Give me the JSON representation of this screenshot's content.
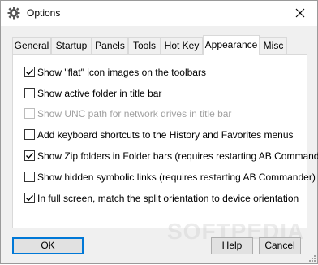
{
  "window": {
    "title": "Options",
    "icon": "gear-icon"
  },
  "tabs": [
    {
      "label": "General",
      "active": false
    },
    {
      "label": "Startup",
      "active": false
    },
    {
      "label": "Panels",
      "active": false
    },
    {
      "label": "Tools",
      "active": false
    },
    {
      "label": "Hot Key",
      "active": false
    },
    {
      "label": "Appearance",
      "active": true
    },
    {
      "label": "Misc",
      "active": false
    }
  ],
  "options": [
    {
      "label": "Show \"flat\" icon images on the toolbars",
      "checked": true,
      "enabled": true
    },
    {
      "label": "Show active folder in title bar",
      "checked": false,
      "enabled": true
    },
    {
      "label": "Show UNC path for network drives in title bar",
      "checked": false,
      "enabled": false
    },
    {
      "label": "Add keyboard shortcuts to the History and Favorites menus",
      "checked": false,
      "enabled": true
    },
    {
      "label": "Show Zip folders in Folder bars (requires restarting AB Commander)",
      "checked": true,
      "enabled": true
    },
    {
      "label": "Show hidden symbolic links (requires restarting AB Commander)",
      "checked": false,
      "enabled": true
    },
    {
      "label": "In full screen, match the split orientation to device orientation",
      "checked": true,
      "enabled": true
    }
  ],
  "buttons": {
    "ok": "OK",
    "help": "Help",
    "cancel": "Cancel"
  },
  "watermark": "SOFTPEDIA",
  "colors": {
    "accent": "#0078d7",
    "disabled_text": "#a0a0a0"
  }
}
